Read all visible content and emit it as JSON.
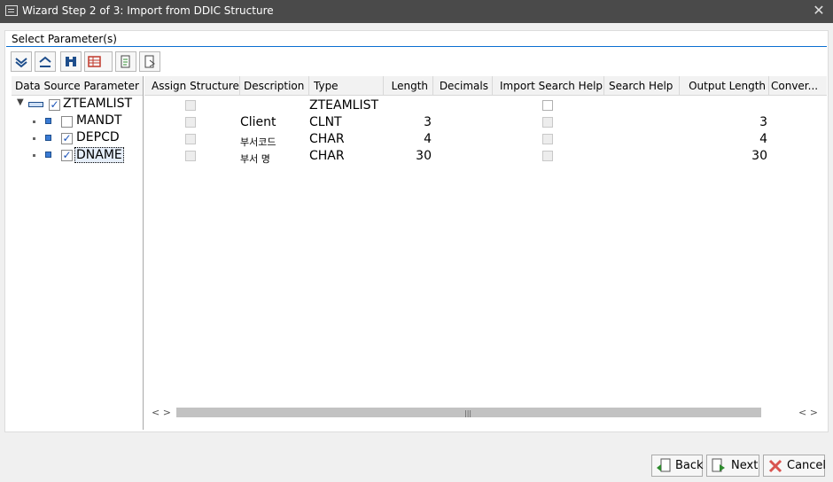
{
  "window": {
    "title": "Wizard Step 2 of 3: Import from DDIC Structure",
    "close_glyph": "✕"
  },
  "section": {
    "title": "Select Parameter(s)"
  },
  "toolbar": {
    "icons": [
      "expand-all-icon",
      "collapse-all-icon",
      "find-icon",
      "layout-icon",
      "import-icon",
      "export-icon"
    ]
  },
  "tree": {
    "header": "Data Source Parameter",
    "nodes": [
      {
        "label": "ZTEAMLIST",
        "checked": "✓"
      },
      {
        "label": "MANDT",
        "checked": ""
      },
      {
        "label": "DEPCD",
        "checked": "✓"
      },
      {
        "label": "DNAME",
        "checked": "✓"
      }
    ]
  },
  "table": {
    "columns": [
      "Assign Structure",
      "Description",
      "Type",
      "Length",
      "Decimals",
      "Import Search Help",
      "Search Help",
      "Output Length",
      "Conver..."
    ],
    "rows": [
      {
        "description": "",
        "type": "ZTEAMLIST",
        "length": "",
        "output_length": ""
      },
      {
        "description": "Client",
        "type": "CLNT",
        "length": "3",
        "output_length": "3"
      },
      {
        "description": "부서코드",
        "type": "CHAR",
        "length": "4",
        "output_length": "4"
      },
      {
        "description": "부서 명",
        "type": "CHAR",
        "length": "30",
        "output_length": "30"
      }
    ]
  },
  "scrollbar": {
    "left_arrows": "< >",
    "right_arrows": "< >",
    "grip": "|||"
  },
  "buttons": {
    "back": "Back",
    "next": "Next",
    "cancel": "Cancel"
  },
  "colors": {
    "accent": "#0a6ed1",
    "titlebar": "#4a4a4a"
  }
}
